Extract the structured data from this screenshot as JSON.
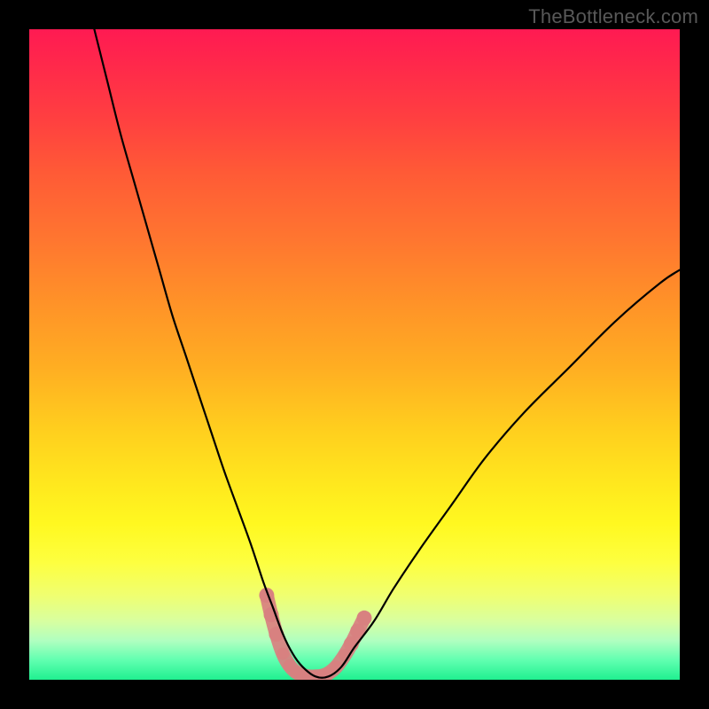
{
  "watermark": "TheBottleneck.com",
  "chart_data": {
    "type": "line",
    "title": "",
    "xlabel": "",
    "ylabel": "",
    "xlim": [
      0,
      100
    ],
    "ylim": [
      0,
      100
    ],
    "grid": false,
    "legend": false,
    "series": [
      {
        "name": "curve",
        "color": "#000000",
        "x": [
          10,
          12,
          14,
          16,
          18,
          20,
          22,
          24,
          26,
          28,
          30,
          32,
          34,
          36,
          37.5,
          39,
          40.5,
          42,
          44,
          46,
          48,
          50,
          53,
          56,
          60,
          65,
          70,
          76,
          83,
          90,
          97,
          100
        ],
        "values": [
          100,
          92,
          84,
          77,
          70,
          63,
          56,
          50,
          44,
          38,
          32,
          26.5,
          21,
          15,
          11,
          7,
          4,
          2,
          0.5,
          0.5,
          2,
          5,
          9,
          14,
          20,
          27,
          34,
          41,
          48,
          55,
          61,
          63
        ]
      },
      {
        "name": "marker-band",
        "color": "#d88080",
        "points": [
          {
            "x": 36.5,
            "y": 13
          },
          {
            "x": 37.2,
            "y": 10
          },
          {
            "x": 38.0,
            "y": 7
          },
          {
            "x": 39.0,
            "y": 4
          },
          {
            "x": 40.0,
            "y": 2.2
          },
          {
            "x": 41.0,
            "y": 1.2
          },
          {
            "x": 42.0,
            "y": 0.7
          },
          {
            "x": 43.0,
            "y": 0.5
          },
          {
            "x": 44.0,
            "y": 0.5
          },
          {
            "x": 45.0,
            "y": 0.6
          },
          {
            "x": 46.0,
            "y": 1.0
          },
          {
            "x": 47.2,
            "y": 2.0
          },
          {
            "x": 48.5,
            "y": 3.8
          },
          {
            "x": 49.5,
            "y": 5.5
          },
          {
            "x": 50.5,
            "y": 7.5
          },
          {
            "x": 51.5,
            "y": 9.5
          }
        ]
      }
    ],
    "gradient_stops": [
      {
        "pos": 0.0,
        "color": "#ff1a52"
      },
      {
        "pos": 0.25,
        "color": "#ff6a30"
      },
      {
        "pos": 0.55,
        "color": "#ffc020"
      },
      {
        "pos": 0.78,
        "color": "#fff820"
      },
      {
        "pos": 0.92,
        "color": "#c8ffb0"
      },
      {
        "pos": 1.0,
        "color": "#20f090"
      }
    ]
  }
}
